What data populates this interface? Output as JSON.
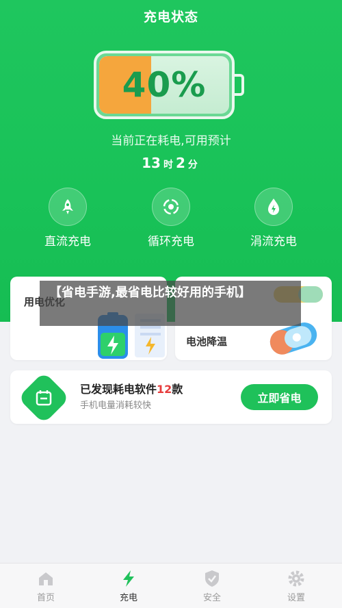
{
  "header": {
    "title": "充电状态"
  },
  "battery": {
    "percent_text": "40%",
    "level": 0.4,
    "remain_label": "当前正在耗电,可用预计",
    "hours": "13",
    "hours_unit": "时",
    "minutes": "2",
    "minutes_unit": "分"
  },
  "modes": [
    {
      "label": "直流充电",
      "icon": "rocket-icon"
    },
    {
      "label": "循环充电",
      "icon": "cycle-icon"
    },
    {
      "label": "涓流充电",
      "icon": "droplet-icon"
    }
  ],
  "feature_cards": {
    "optimize": {
      "title": "用电优化"
    },
    "cooling": {
      "title": "电池降温"
    }
  },
  "banner": {
    "text": "【省电手游,最省电比较好用的手机】"
  },
  "app_card": {
    "title_prefix": "已发现耗电软件",
    "count": "12",
    "title_suffix": "款",
    "subtitle": "手机电量消耗较快",
    "button": "立即省电"
  },
  "nav": [
    {
      "label": "首页",
      "icon": "home-icon"
    },
    {
      "label": "充电",
      "icon": "bolt-icon"
    },
    {
      "label": "安全",
      "icon": "shield-icon"
    },
    {
      "label": "设置",
      "icon": "gear-icon"
    }
  ],
  "colors": {
    "primary": "#1fc15a",
    "battery_fill": "#f5a63d",
    "alert": "#e63c3c"
  }
}
